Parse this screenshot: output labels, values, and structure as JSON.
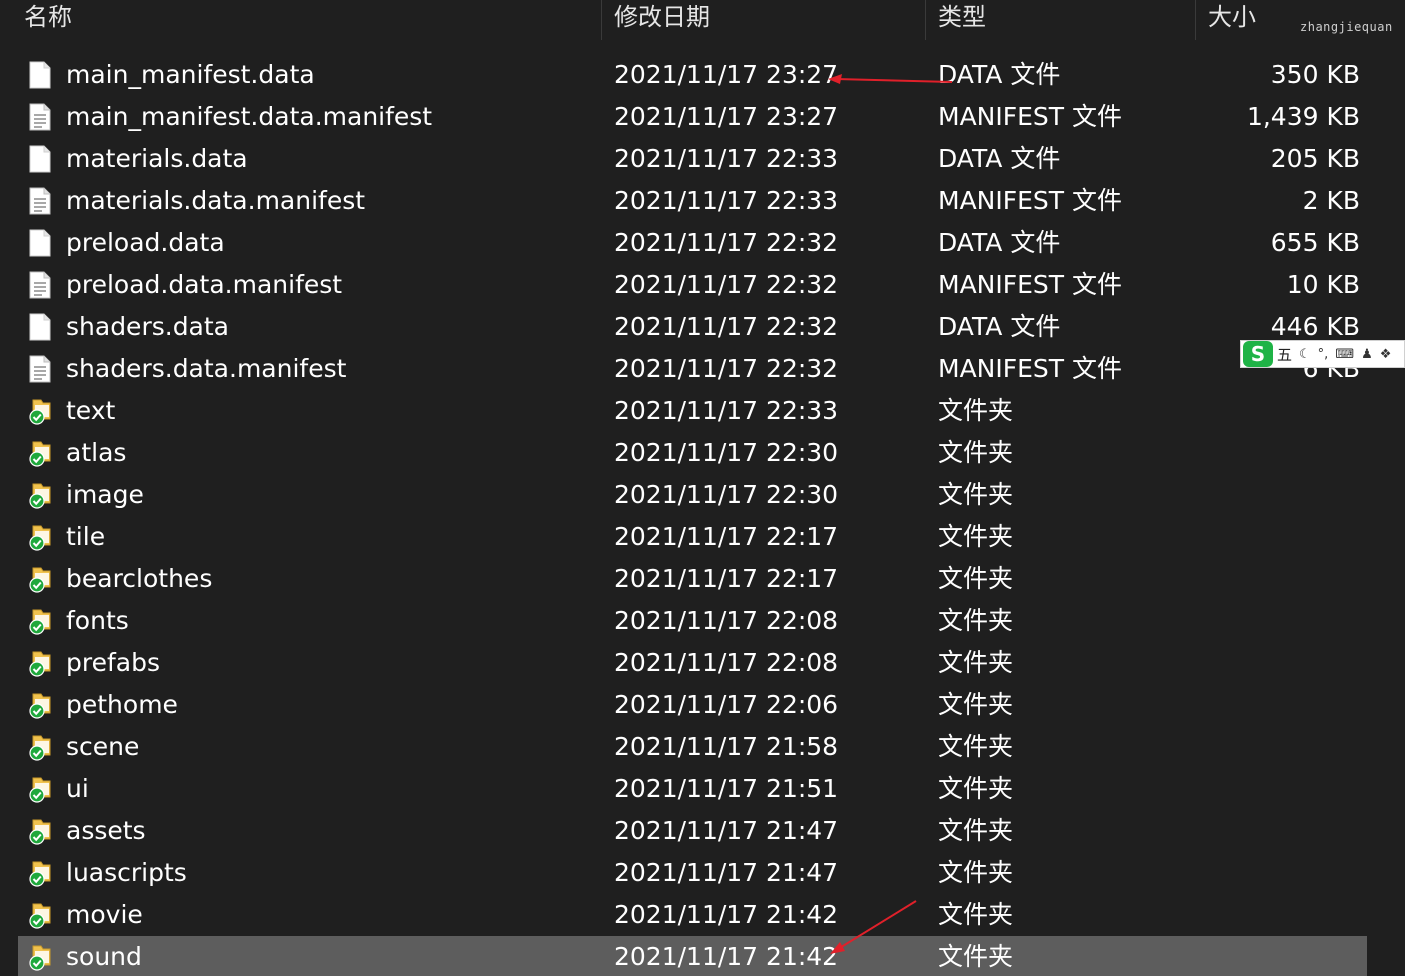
{
  "header": {
    "col_name": "名称",
    "col_date": "修改日期",
    "col_type": "类型",
    "col_size": "大小",
    "watermark": "zhangjiequan"
  },
  "files": [
    {
      "name": "main_manifest.data",
      "date": "2021/11/17 23:27",
      "type": "DATA 文件",
      "size": "350 KB",
      "icon": "file-icon"
    },
    {
      "name": "main_manifest.data.manifest",
      "date": "2021/11/17 23:27",
      "type": "MANIFEST 文件",
      "size": "1,439 KB",
      "icon": "text-file-icon"
    },
    {
      "name": "materials.data",
      "date": "2021/11/17 22:33",
      "type": "DATA 文件",
      "size": "205 KB",
      "icon": "file-icon"
    },
    {
      "name": "materials.data.manifest",
      "date": "2021/11/17 22:33",
      "type": "MANIFEST 文件",
      "size": "2 KB",
      "icon": "text-file-icon"
    },
    {
      "name": "preload.data",
      "date": "2021/11/17 22:32",
      "type": "DATA 文件",
      "size": "655 KB",
      "icon": "file-icon"
    },
    {
      "name": "preload.data.manifest",
      "date": "2021/11/17 22:32",
      "type": "MANIFEST 文件",
      "size": "10 KB",
      "icon": "text-file-icon"
    },
    {
      "name": "shaders.data",
      "date": "2021/11/17 22:32",
      "type": "DATA 文件",
      "size": "446 KB",
      "icon": "file-icon"
    },
    {
      "name": "shaders.data.manifest",
      "date": "2021/11/17 22:32",
      "type": "MANIFEST 文件",
      "size": "6 KB",
      "icon": "text-file-icon"
    },
    {
      "name": "text",
      "date": "2021/11/17 22:33",
      "type": "文件夹",
      "size": "",
      "icon": "folder-synced-icon"
    },
    {
      "name": "atlas",
      "date": "2021/11/17 22:30",
      "type": "文件夹",
      "size": "",
      "icon": "folder-synced-icon"
    },
    {
      "name": "image",
      "date": "2021/11/17 22:30",
      "type": "文件夹",
      "size": "",
      "icon": "folder-synced-icon"
    },
    {
      "name": "tile",
      "date": "2021/11/17 22:17",
      "type": "文件夹",
      "size": "",
      "icon": "folder-synced-icon"
    },
    {
      "name": "bearclothes",
      "date": "2021/11/17 22:17",
      "type": "文件夹",
      "size": "",
      "icon": "folder-synced-icon"
    },
    {
      "name": "fonts",
      "date": "2021/11/17 22:08",
      "type": "文件夹",
      "size": "",
      "icon": "folder-synced-icon"
    },
    {
      "name": "prefabs",
      "date": "2021/11/17 22:08",
      "type": "文件夹",
      "size": "",
      "icon": "folder-synced-icon"
    },
    {
      "name": "pethome",
      "date": "2021/11/17 22:06",
      "type": "文件夹",
      "size": "",
      "icon": "folder-synced-icon"
    },
    {
      "name": "scene",
      "date": "2021/11/17 21:58",
      "type": "文件夹",
      "size": "",
      "icon": "folder-synced-icon"
    },
    {
      "name": "ui",
      "date": "2021/11/17 21:51",
      "type": "文件夹",
      "size": "",
      "icon": "folder-synced-icon"
    },
    {
      "name": "assets",
      "date": "2021/11/17 21:47",
      "type": "文件夹",
      "size": "",
      "icon": "folder-synced-icon"
    },
    {
      "name": "luascripts",
      "date": "2021/11/17 21:47",
      "type": "文件夹",
      "size": "",
      "icon": "folder-synced-icon"
    },
    {
      "name": "movie",
      "date": "2021/11/17 21:42",
      "type": "文件夹",
      "size": "",
      "icon": "folder-synced-icon"
    },
    {
      "name": "sound",
      "date": "2021/11/17 21:42",
      "type": "文件夹",
      "size": "",
      "icon": "folder-synced-icon",
      "selected": true
    }
  ],
  "ime_toolbar": {
    "logo": "S",
    "mode": "五"
  },
  "colors": {
    "background": "#1f1f1f",
    "selected_row": "#5d5d5d",
    "annotation_arrow": "#e0202a",
    "sync_check": "#1fa83c",
    "folder": "#f0c24e"
  }
}
